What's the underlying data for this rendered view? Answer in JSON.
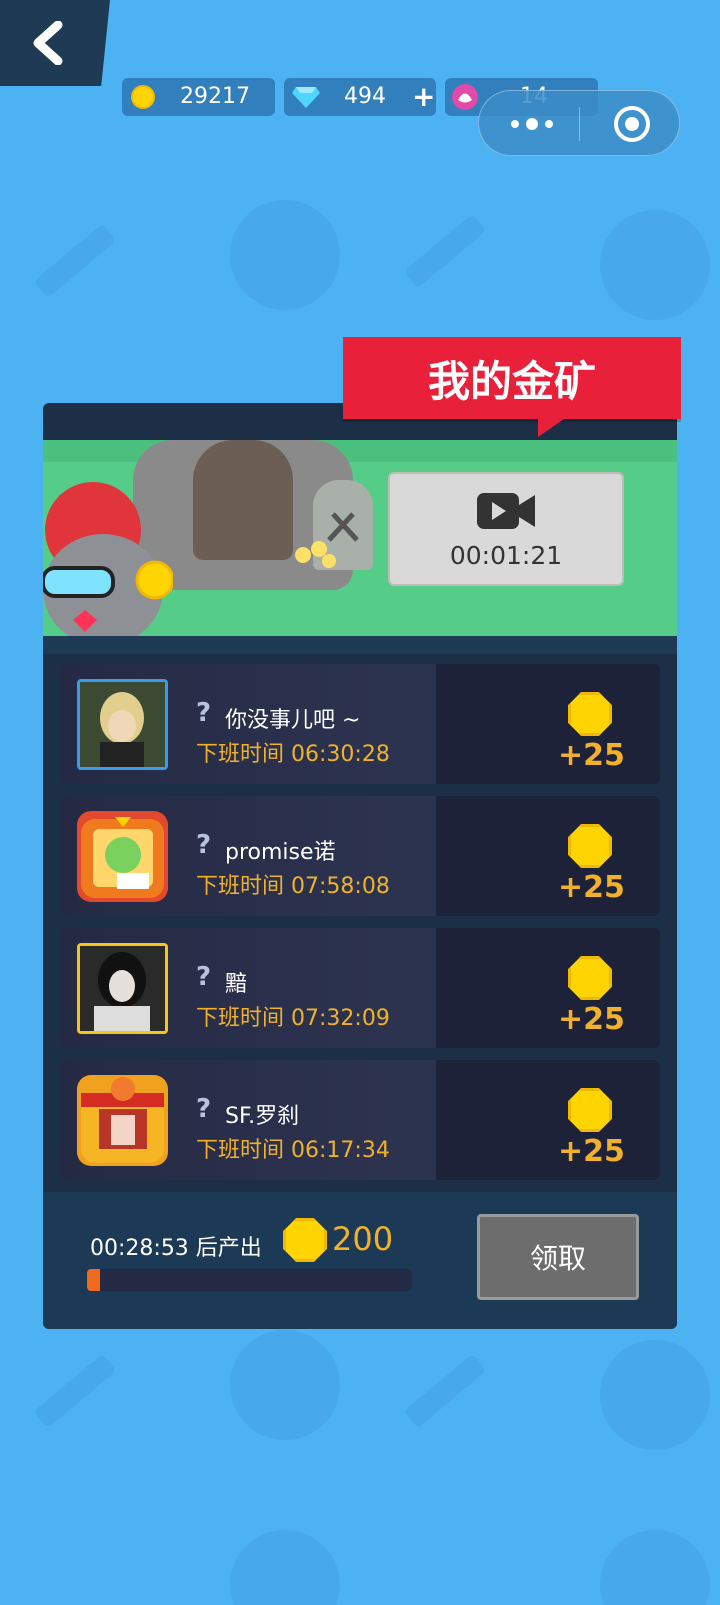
{
  "resources": {
    "gold": "29217",
    "diamond": "494",
    "diamond_add": "+",
    "flower": "14"
  },
  "capsule": {
    "more_icon": "more-dots-icon",
    "target_icon": "target-icon"
  },
  "title": "我的金矿",
  "video": {
    "icon": "video-camera-icon",
    "time": "00:01:21"
  },
  "workers": [
    {
      "q": "?",
      "name": "你没事儿吧 ~",
      "time_label": "下班时间",
      "time": "06:30:28",
      "reward": "+25",
      "avatar_color": "#2a6fb8"
    },
    {
      "q": "?",
      "name": "promise诺",
      "time_label": "下班时间",
      "time": "07:58:08",
      "reward": "+25",
      "avatar_color": "#e14a2c"
    },
    {
      "q": "?",
      "name": "黯",
      "time_label": "下班时间",
      "time": "07:32:09",
      "reward": "+25",
      "avatar_color": "#e8b11c"
    },
    {
      "q": "?",
      "name": "SF.罗刹",
      "time_label": "下班时间",
      "time": "06:17:34",
      "reward": "+25",
      "avatar_color": "#d63324"
    }
  ],
  "footer": {
    "countdown": "00:28:53 后产出",
    "amount": "200",
    "progress": 0.04,
    "claim": "领取"
  },
  "colors": {
    "background": "#4db2f2",
    "banner": "#e8203a",
    "accent": "#f2b12a",
    "panel": "#1c2f46"
  }
}
